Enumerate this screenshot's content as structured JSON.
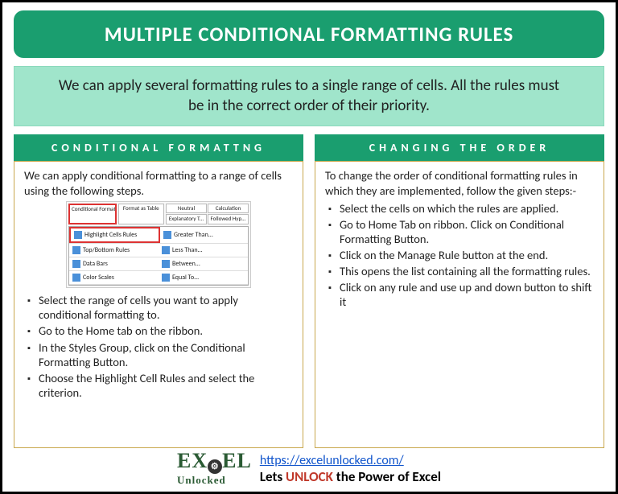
{
  "title": "MULTIPLE CONDITIONAL FORMATTING RULES",
  "intro": "We can apply several formatting rules to a single range of cells. All the rules must be in the correct order of their priority.",
  "left": {
    "heading": "CONDITIONAL FORMATTNG",
    "lead": "We can apply conditional formatting to a range of cells using the following steps.",
    "bullets": [
      "Select the range of cells you want to apply conditional formatting to.",
      "Go to the Home tab on the ribbon.",
      "In the Styles Group, click on the Conditional Formatting Button.",
      "Choose the Highlight Cell Rules and select the criterion."
    ],
    "ribbon": {
      "btn1": "Conditional Formatting",
      "btn2": "Format as Table",
      "s1": "Neutral",
      "s2": "Calculation",
      "s3": "Explanatory T...",
      "s4": "Followed Hyp...",
      "rows": [
        [
          "Highlight Cells Rules",
          "Greater Than..."
        ],
        [
          "Top/Bottom Rules",
          "Less Than..."
        ],
        [
          "Data Bars",
          "Between..."
        ],
        [
          "Color Scales",
          "Equal To..."
        ]
      ]
    }
  },
  "right": {
    "heading": "CHANGING THE ORDER",
    "lead": "To change the order of conditional formatting rules in which they are implemented, follow the given steps:-",
    "bullets": [
      "Select the cells on which the rules are applied.",
      "Go to Home Tab on ribbon. Click on Conditional Formatting Button.",
      "Click on the Manage Rule button at the end.",
      "This opens the list containing all the formatting rules.",
      "Click on any rule and use up and down button to shift it"
    ]
  },
  "footer": {
    "logo_big": "EX   EL",
    "logo_small": "Unlocked",
    "url": "https://excelunlocked.com/",
    "tagline_pre": "Lets ",
    "tagline_highlight": "UNLOCK",
    "tagline_post": " the Power of Excel"
  }
}
